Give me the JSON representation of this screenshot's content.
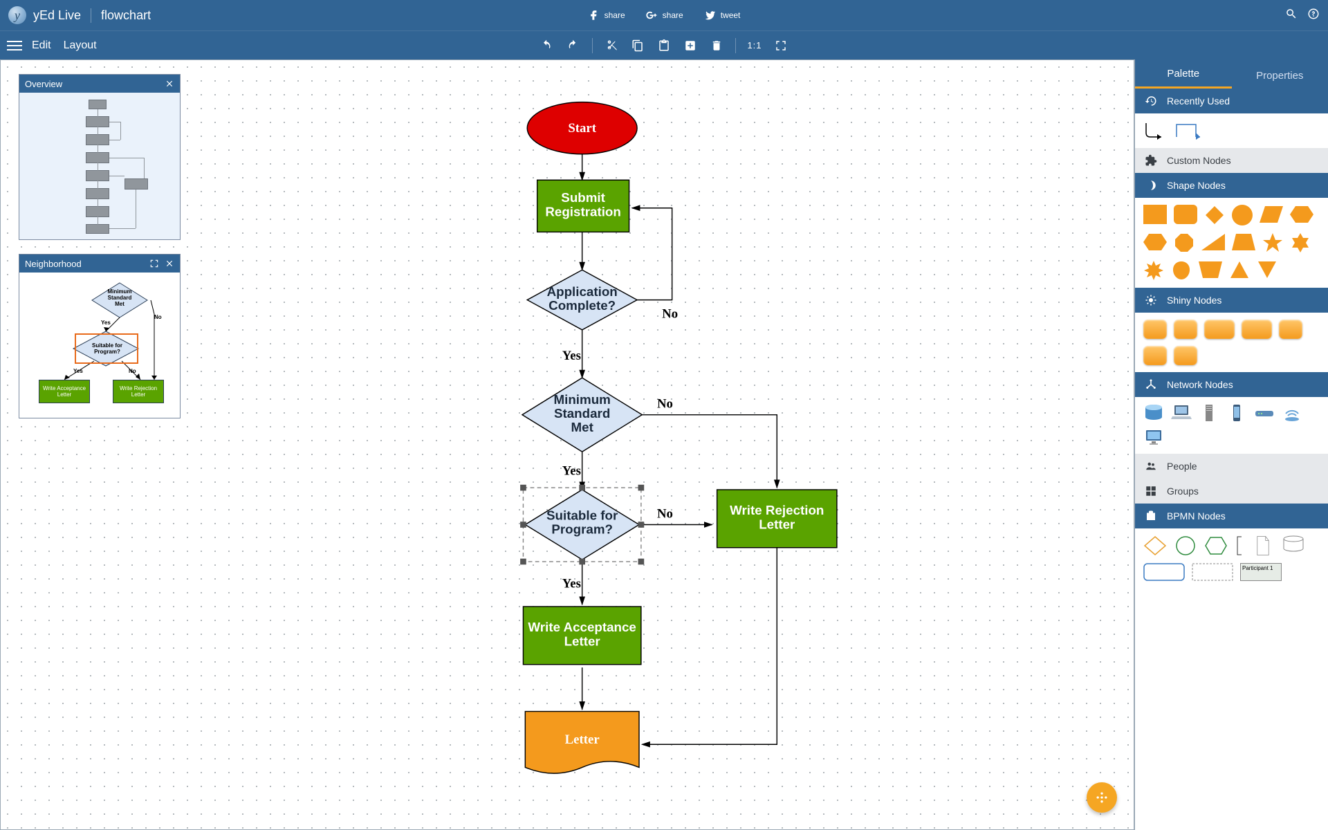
{
  "app": {
    "name": "yEd Live",
    "document": "flowchart"
  },
  "share": {
    "fb": "share",
    "gplus": "share",
    "tw": "tweet"
  },
  "menu": {
    "edit": "Edit",
    "layout": "Layout",
    "ratio": "1:1"
  },
  "panels": {
    "overview": {
      "title": "Overview"
    },
    "neighborhood": {
      "title": "Neighborhood",
      "nodes": {
        "min_std": "Minimum\nStandard\nMet",
        "suitable": "Suitable for\nProgram?",
        "accept": "Write Acceptance\nLetter",
        "reject": "Write Rejection\nLetter"
      },
      "edges": {
        "yes": "Yes",
        "no": "No"
      }
    }
  },
  "flowchart": {
    "nodes": {
      "start": "Start",
      "submit": "Submit\nRegistration",
      "app_complete": "Application\nComplete?",
      "min_std": "Minimum\nStandard\nMet",
      "suitable": "Suitable for\nProgram?",
      "accept": "Write Acceptance\nLetter",
      "reject": "Write Rejection\nLetter",
      "letter": "Letter"
    },
    "edges": {
      "yes": "Yes",
      "no": "No"
    },
    "selected_node": "suitable"
  },
  "sidebar": {
    "tabs": {
      "palette": "Palette",
      "properties": "Properties"
    },
    "sections": {
      "recent": "Recently Used",
      "custom": "Custom Nodes",
      "shape": "Shape Nodes",
      "shiny": "Shiny Nodes",
      "network": "Network Nodes",
      "people": "People",
      "groups": "Groups",
      "bpmn": "BPMN Nodes"
    },
    "bpmn_participant": "Participant 1"
  }
}
